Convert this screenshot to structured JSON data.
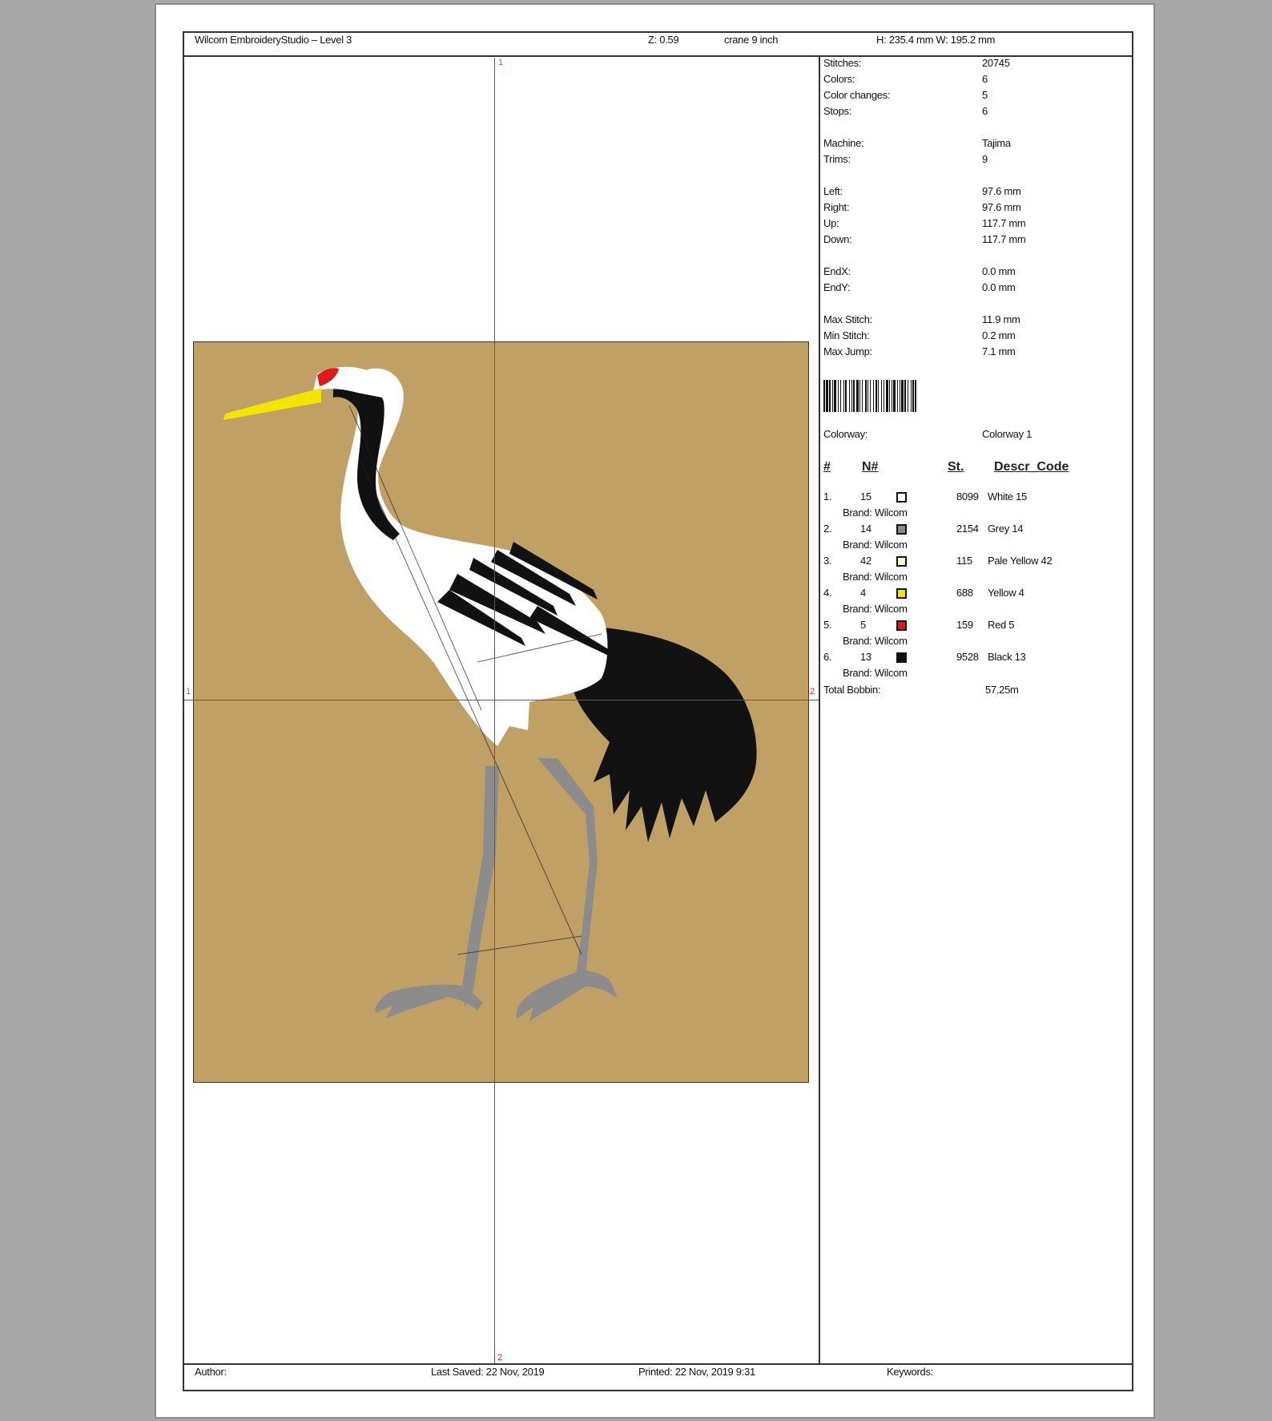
{
  "header": {
    "app_title": "Wilcom EmbroideryStudio – Level 3",
    "zoom": "Z: 0.59",
    "design_name": "crane 9 inch",
    "dimensions": "H: 235.4 mm   W: 195.2 mm"
  },
  "stats": [
    {
      "label": "Stitches:",
      "value": "20745"
    },
    {
      "label": "Colors:",
      "value": "6"
    },
    {
      "label": "Color changes:",
      "value": "5"
    },
    {
      "label": "Stops:",
      "value": "6"
    },
    {
      "label": "Machine:",
      "value": "Tajima"
    },
    {
      "label": "Trims:",
      "value": "9"
    },
    {
      "label": "Left:",
      "value": "97.6 mm"
    },
    {
      "label": "Right:",
      "value": "97.6 mm"
    },
    {
      "label": "Up:",
      "value": "117.7 mm"
    },
    {
      "label": "Down:",
      "value": "117.7 mm"
    },
    {
      "label": "EndX:",
      "value": "0.0 mm"
    },
    {
      "label": "EndY:",
      "value": "0.0 mm"
    },
    {
      "label": "Max Stitch:",
      "value": "11.9 mm"
    },
    {
      "label": "Min Stitch:",
      "value": "0.2 mm"
    },
    {
      "label": "Max Jump:",
      "value": "7.1 mm"
    }
  ],
  "colorway": {
    "label": "Colorway:",
    "value": "Colorway 1"
  },
  "table_headers": {
    "num": "#",
    "needle": "N#",
    "stitches": "St.",
    "descr": "Descr_Code"
  },
  "colors": [
    {
      "idx": "1.",
      "needle": "15",
      "color": "#ffffff",
      "stitches": "8099",
      "name": "White 15",
      "brand": "Brand: Wilcom"
    },
    {
      "idx": "2.",
      "needle": "14",
      "color": "#8a8a8a",
      "stitches": "2154",
      "name": "Grey 14",
      "brand": "Brand: Wilcom"
    },
    {
      "idx": "3.",
      "needle": "42",
      "color": "#fbf7c8",
      "stitches": "115",
      "name": "Pale Yellow 42",
      "brand": "Brand: Wilcom"
    },
    {
      "idx": "4.",
      "needle": "4",
      "color": "#f2e600",
      "stitches": "688",
      "name": "Yellow 4",
      "brand": "Brand: Wilcom"
    },
    {
      "idx": "5.",
      "needle": "5",
      "color": "#e01818",
      "stitches": "159",
      "name": "Red 5",
      "brand": "Brand: Wilcom"
    },
    {
      "idx": "6.",
      "needle": "13",
      "color": "#111111",
      "stitches": "9528",
      "name": "Black 13",
      "brand": "Brand: Wilcom"
    }
  ],
  "total_bobbin": {
    "label": "Total Bobbin:",
    "value": "57.25m"
  },
  "footer": {
    "author": "Author:",
    "last_saved": "Last Saved: 22 Nov, 2019",
    "printed": "Printed: 22 Nov, 2019  9:31",
    "keywords": "Keywords:"
  },
  "axis_markers": {
    "one": "1",
    "two": "2"
  },
  "design_colors": {
    "background": "#c0a064",
    "crosshair": "#e42020",
    "marker_start": "#19c219"
  }
}
